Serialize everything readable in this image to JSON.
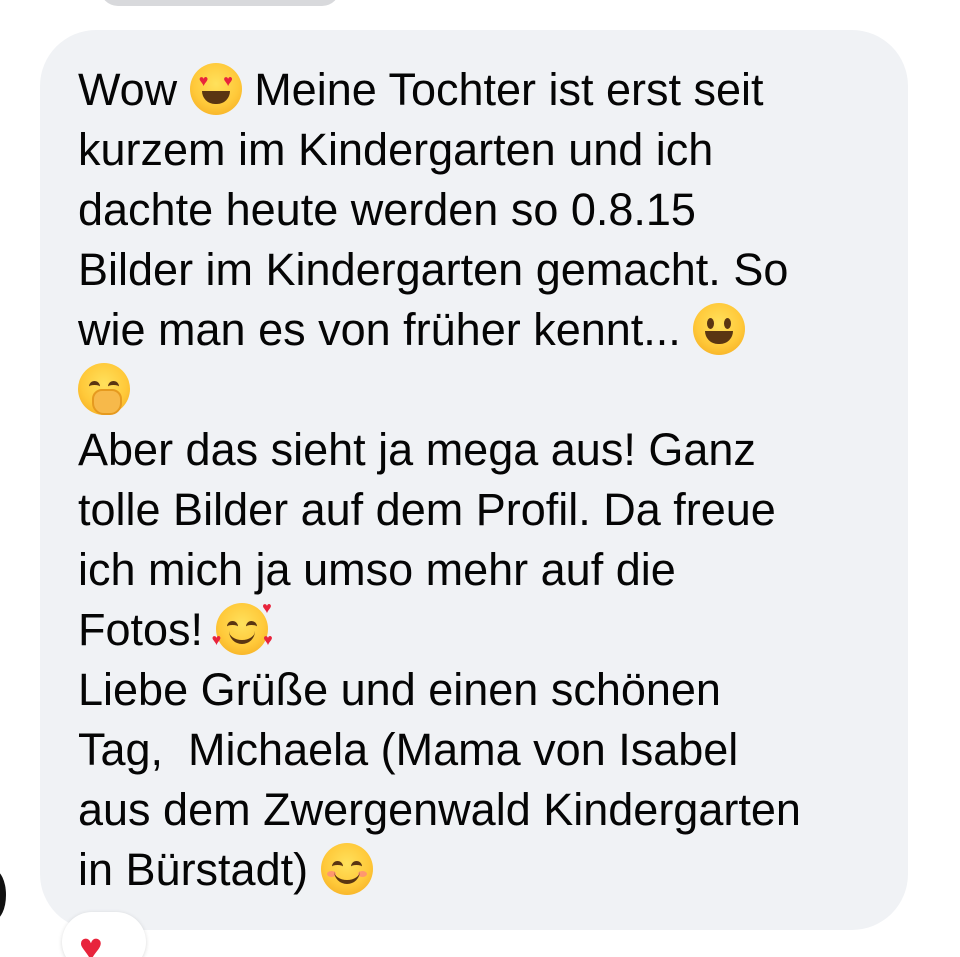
{
  "message": {
    "lines": [
      {
        "before": "Wow ",
        "emoji": "heart-eyes-emoji",
        "after": " Meine Tochter ist erst seit"
      },
      {
        "text": "kurzem im Kindergarten und ich"
      },
      {
        "text": "dachte heute werden so 0.8.15"
      },
      {
        "text": "Bilder im Kindergarten gemacht. So"
      },
      {
        "before": "wie man es von früher kennt... ",
        "emoji": "grinning-emoji"
      },
      {
        "emoji": "hand-over-mouth-emoji"
      },
      {
        "text": "Aber das sieht ja mega aus! Ganz"
      },
      {
        "text": "tolle Bilder auf dem Profil. Da freue"
      },
      {
        "text": "ich mich ja umso mehr auf die"
      },
      {
        "before": "Fotos! ",
        "emoji": "smiling-face-with-hearts-emoji"
      },
      {
        "text": "Liebe Grüße und einen schönen"
      },
      {
        "text": "Tag,  Michaela (Mama von Isabel"
      },
      {
        "text": "aus dem Zwergenwald Kindergarten"
      },
      {
        "before": "in Bürstadt) ",
        "emoji": "smiling-blush-emoji"
      }
    ]
  },
  "reaction": {
    "icon": "heart-reaction-icon",
    "color": "#e8243c"
  },
  "colors": {
    "bubble": "#f0f2f5",
    "text": "#050505"
  }
}
